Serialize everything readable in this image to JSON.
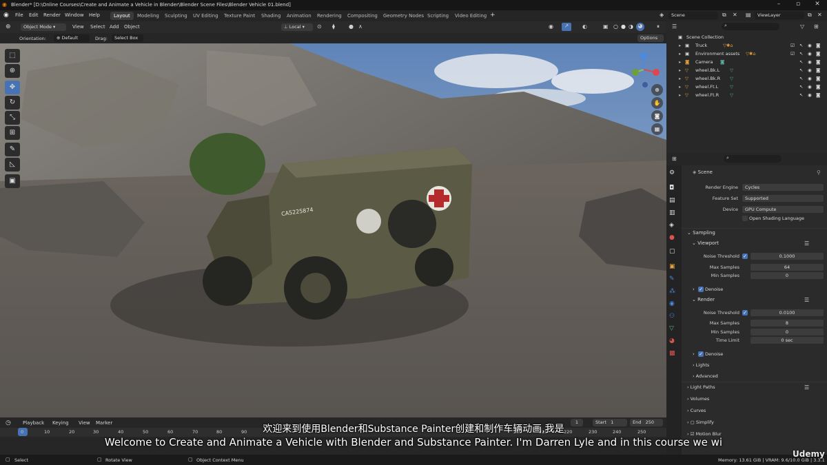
{
  "title": "Blender* [D:\\Online Courses\\Create and Animate a Vehicle in Blender\\Blender Scene Files\\Blender Vehicle 01.blend]",
  "menu": [
    "File",
    "Edit",
    "Render",
    "Window",
    "Help"
  ],
  "workspaces": [
    "Layout",
    "Modeling",
    "Sculpting",
    "UV Editing",
    "Texture Paint",
    "Shading",
    "Animation",
    "Rendering",
    "Compositing",
    "Geometry Nodes",
    "Scripting",
    "Video Editing"
  ],
  "top_right": {
    "scene": "Scene",
    "view_layer": "ViewLayer"
  },
  "viewport_header": {
    "mode": "Object Mode",
    "view": "View",
    "select": "Select",
    "add": "Add",
    "object": "Object",
    "pivot": "Local",
    "orientation_label": "Orientation:",
    "orientation": "Default",
    "drag_label": "Drag:",
    "drag": "Select Box",
    "options": "Options"
  },
  "vehicle_plate": "CA5225874",
  "outliner": {
    "root": "Scene Collection",
    "items": [
      "Truck",
      "Environment assets",
      "Camera",
      "wheel.Bk.L",
      "wheel.Bk.R",
      "wheel.Ft.L",
      "wheel.Ft.R"
    ]
  },
  "properties": {
    "context": "Scene",
    "render_engine_label": "Render Engine",
    "render_engine": "Cycles",
    "feature_set_label": "Feature Set",
    "feature_set": "Supported",
    "device_label": "Device",
    "device": "GPU Compute",
    "osl": "Open Shading Language",
    "sampling": "Sampling",
    "viewport": "Viewport",
    "noise_threshold_label": "Noise Threshold",
    "vp_noise": "0.1000",
    "max_samples_label": "Max Samples",
    "vp_max": "64",
    "min_samples_label": "Min Samples",
    "vp_min": "0",
    "denoise": "Denoise",
    "render": "Render",
    "r_noise": "0.0100",
    "r_max": "8",
    "r_min": "0",
    "time_limit_label": "Time Limit",
    "time_limit": "0 sec",
    "lights": "Lights",
    "advanced": "Advanced",
    "light_paths": "Light Paths",
    "volumes": "Volumes",
    "curves": "Curves",
    "simplify": "Simplify",
    "motion_blur": "Motion Blur"
  },
  "timeline": {
    "playback": "Playback",
    "keying": "Keying",
    "view": "View",
    "marker": "Marker",
    "start_label": "Start",
    "start": "1",
    "end_label": "End",
    "end": "250",
    "frame": "1",
    "ticks": [
      "0",
      "10",
      "20",
      "30",
      "40",
      "50",
      "60",
      "70",
      "80",
      "90",
      "200",
      "210",
      "220",
      "230",
      "240",
      "250"
    ]
  },
  "status": {
    "select": "Select",
    "rotate": "Rotate View",
    "context": "Object Context Menu",
    "memory": "Memory: 13.61 GiB | VRAM: 9.6/10.0 GiB | 3.3.1"
  },
  "subtitle_cn": "欢迎来到使用Blender和Substance Painter创建和制作车辆动画,我是",
  "subtitle_en": "Welcome to Create and Animate a Vehicle with Blender and Substance Painter. I'm Darren Lyle and in this course we wi",
  "watermark": "Udemy"
}
